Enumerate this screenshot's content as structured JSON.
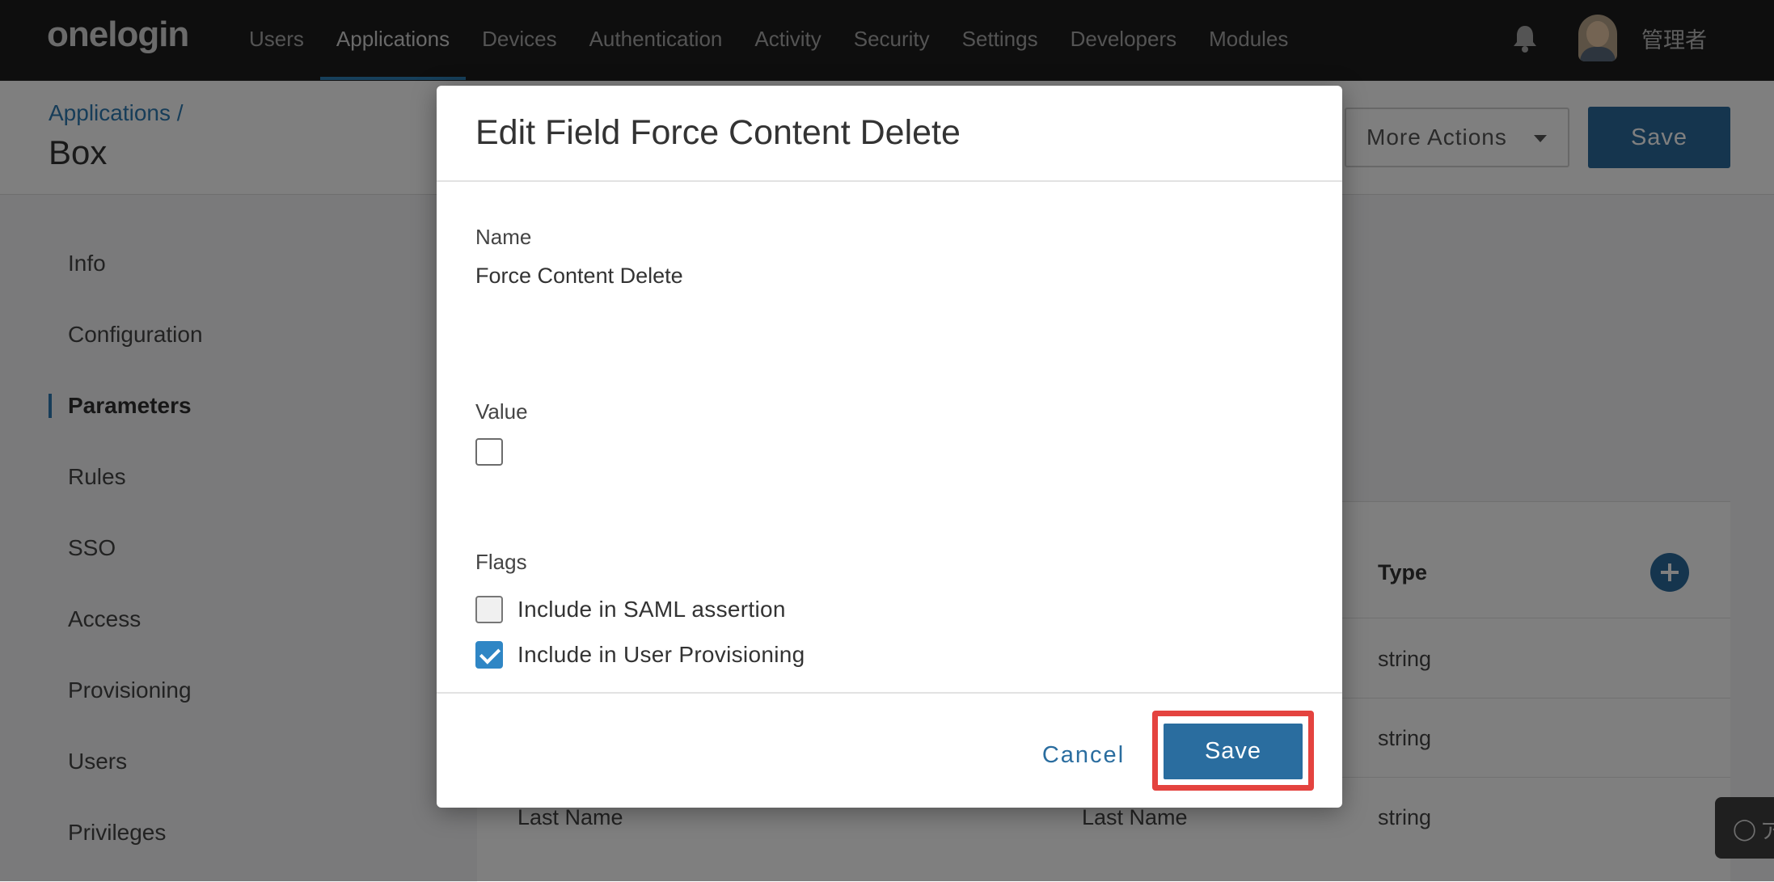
{
  "topbar": {
    "logo": "onelogin",
    "nav": [
      "Users",
      "Applications",
      "Devices",
      "Authentication",
      "Activity",
      "Security",
      "Settings",
      "Developers",
      "Modules"
    ],
    "active_nav": "Applications",
    "username": "管理者"
  },
  "page": {
    "breadcrumb": "Applications /",
    "title": "Box",
    "more_actions_label": "More Actions",
    "save_label": "Save"
  },
  "sidebar": {
    "items": [
      "Info",
      "Configuration",
      "Parameters",
      "Rules",
      "SSO",
      "Access",
      "Provisioning",
      "Users",
      "Privileges"
    ],
    "active": "Parameters"
  },
  "table": {
    "type_header": "Type",
    "rows": [
      {
        "field": "",
        "value": "",
        "type": "string"
      },
      {
        "field": "",
        "value": "",
        "type": "string"
      },
      {
        "field": "Last Name",
        "value": "Last Name",
        "type": "string"
      }
    ]
  },
  "help_widget": {
    "text": "ア"
  },
  "modal": {
    "title": "Edit Field Force Content Delete",
    "name_label": "Name",
    "name_value": "Force Content Delete",
    "value_label": "Value",
    "value_checked": false,
    "flags_label": "Flags",
    "flags": [
      {
        "label": "Include in SAML assertion",
        "checked": false
      },
      {
        "label": "Include in User Provisioning",
        "checked": true
      }
    ],
    "cancel_label": "Cancel",
    "save_label": "Save",
    "highlight_color": "#e4433f"
  },
  "colors": {
    "topbar_bg": "#1c1c1c",
    "accent": "#2a6d9f",
    "checkbox_checked": "#2f86c5"
  }
}
